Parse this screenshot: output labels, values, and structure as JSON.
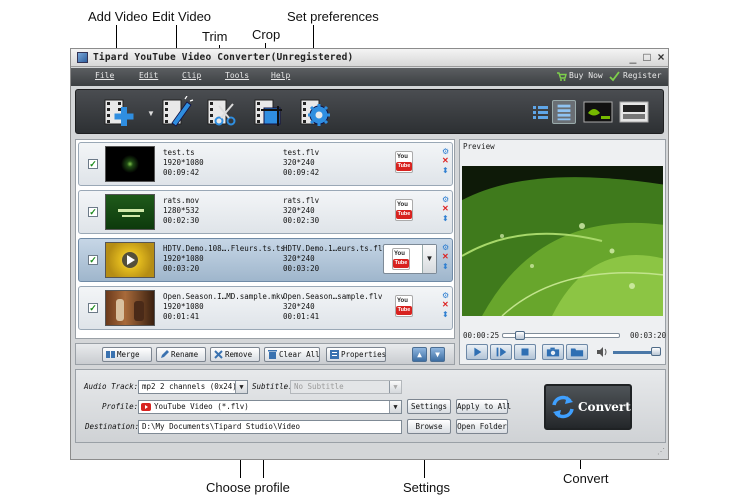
{
  "callouts": {
    "add_video": "Add Video",
    "edit_video": "Edit Video",
    "trim": "Trim",
    "crop": "Crop",
    "set_preferences": "Set preferences",
    "choose_profile": "Choose profile",
    "settings": "Settings",
    "convert": "Convert"
  },
  "window": {
    "title": "Tipard YouTube Video Converter(Unregistered)",
    "minimize": "_",
    "maximize": "□",
    "close": "×"
  },
  "menu": {
    "items": [
      "File",
      "Edit",
      "Clip",
      "Tools",
      "Help"
    ],
    "buy_now": "Buy Now",
    "register": "Register"
  },
  "files": [
    {
      "source_name": "test.ts",
      "source_res": "1920*1080",
      "source_dur": "00:09:42",
      "target_name": "test.flv",
      "target_res": "320*240",
      "target_dur": "00:09:42",
      "checked": "✓",
      "selected": false,
      "thumb": "dark"
    },
    {
      "source_name": "rats.mov",
      "source_res": "1280*532",
      "source_dur": "00:02:30",
      "target_name": "rats.flv",
      "target_res": "320*240",
      "target_dur": "00:02:30",
      "checked": "✓",
      "selected": false,
      "thumb": "green"
    },
    {
      "source_name": "HDTV.Demo.108….Fleurs.ts.ts",
      "source_res": "1920*1080",
      "source_dur": "00:03:20",
      "target_name": "HDTV.Demo.1…eurs.ts.flv",
      "target_res": "320*240",
      "target_dur": "00:03:20",
      "checked": "✓",
      "selected": true,
      "thumb": "flower"
    },
    {
      "source_name": "Open.Season.I…MD.sample.mkv",
      "source_res": "1920*1080",
      "source_dur": "00:01:41",
      "target_name": "Open.Season…sample.flv",
      "target_res": "320*240",
      "target_dur": "00:01:41",
      "checked": "✓",
      "selected": false,
      "thumb": "room"
    }
  ],
  "youtube": {
    "you": "You",
    "tube": "Tube"
  },
  "list_buttons": {
    "merge": "Merge",
    "rename": "Rename",
    "remove": "Remove",
    "clear_all": "Clear All",
    "properties": "Properties"
  },
  "preview": {
    "label": "Preview",
    "current_time": "00:00:25",
    "total_time": "00:03:20",
    "progress_fraction": 0.125,
    "volume_fraction": 1.0
  },
  "bottom": {
    "audio_track_label": "Audio Track:",
    "audio_track_value": "mp2 2 channels (0x24)",
    "subtitle_label": "Subtitle:",
    "subtitle_value": "No Subtitle",
    "profile_label": "Profile:",
    "profile_value": "YouTube Video (*.flv)",
    "destination_label": "Destination:",
    "destination_value": "D:\\My Documents\\Tipard Studio\\Video",
    "settings": "Settings",
    "apply_to_all": "Apply to All",
    "browse": "Browse",
    "open_folder": "Open Folder",
    "convert": "Convert"
  },
  "colors": {
    "toolbar_blue": "#2f8ee0",
    "accent_red": "#d8221f",
    "check_green": "#1a8a1a"
  }
}
